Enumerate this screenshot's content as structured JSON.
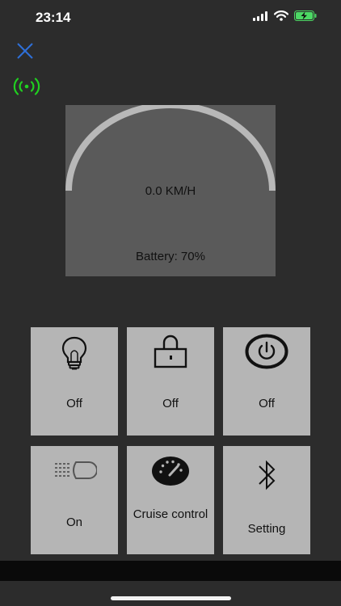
{
  "status_bar": {
    "time": "23:14",
    "icons": [
      "cellular-signal-icon",
      "wifi-icon",
      "battery-charging-icon"
    ]
  },
  "header": {
    "close_icon": "close-icon",
    "connection_icon": "connection-signal-icon",
    "colors": {
      "close": "#2e6fd8",
      "connection": "#20d020"
    }
  },
  "gauge": {
    "speed_text": "0.0 KM/H",
    "battery_text": "Battery: 70%"
  },
  "controls": [
    {
      "icon": "light-bulb-icon",
      "label": "Off"
    },
    {
      "icon": "lock-icon",
      "label": "Off"
    },
    {
      "icon": "power-icon",
      "label": "Off"
    },
    {
      "icon": "headlight-icon",
      "label": "On"
    },
    {
      "icon": "speedometer-icon",
      "label": "Cruise control"
    },
    {
      "icon": "bluetooth-icon",
      "label": "Setting"
    }
  ],
  "colors": {
    "background": "#2c2c2c",
    "panel": "#5a5a5a",
    "tile": "#b5b5b5",
    "battery_status": "#4cd964"
  }
}
